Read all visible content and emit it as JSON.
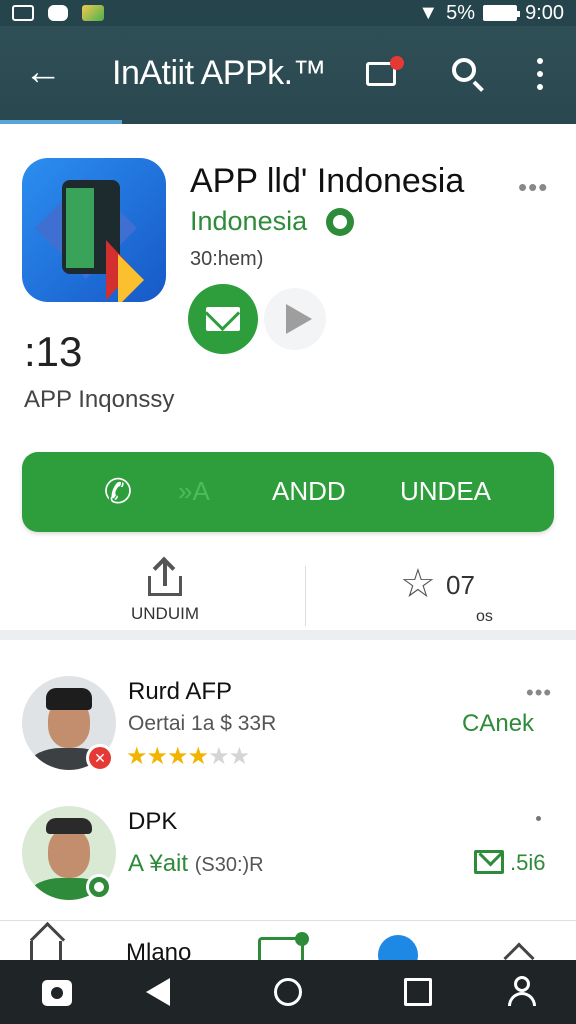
{
  "status_bar": {
    "battery": "5%",
    "time": "9:00"
  },
  "app_bar": {
    "title": "InAtiit APPk.™"
  },
  "app": {
    "name": "APP lld' Indonesia",
    "developer": "Indonesia",
    "size": "30:hem)",
    "rating_value": ":13",
    "rating_subtitle": "APP Inqonssy",
    "install": {
      "faint_label": "»A",
      "label_1": "ANDD",
      "label_2": "UNDEA"
    },
    "share_label": "UNDUIM",
    "stars": {
      "count": "07",
      "label": "os"
    }
  },
  "list": [
    {
      "name": "Rurd AFP",
      "subtitle": "Oertai 1a $ 33R",
      "rating": 3.5,
      "action": "CAnek"
    },
    {
      "name": "DPK",
      "subtitle_green": "A ¥ait",
      "subtitle_grey": "(S30:)R",
      "action": ".5i6"
    }
  ],
  "bottom_tabs": {
    "label": "Mlano"
  },
  "colors": {
    "app_bar": "#2f4f57",
    "accent_green": "#2e9e3d",
    "badge_red": "#e53935"
  },
  "icons": [
    "back-arrow-icon",
    "message-icon",
    "search-icon",
    "more-vert-icon",
    "phone-icon",
    "share-icon",
    "star-icon",
    "mail-icon",
    "play-icon",
    "home-icon",
    "user-icon"
  ]
}
